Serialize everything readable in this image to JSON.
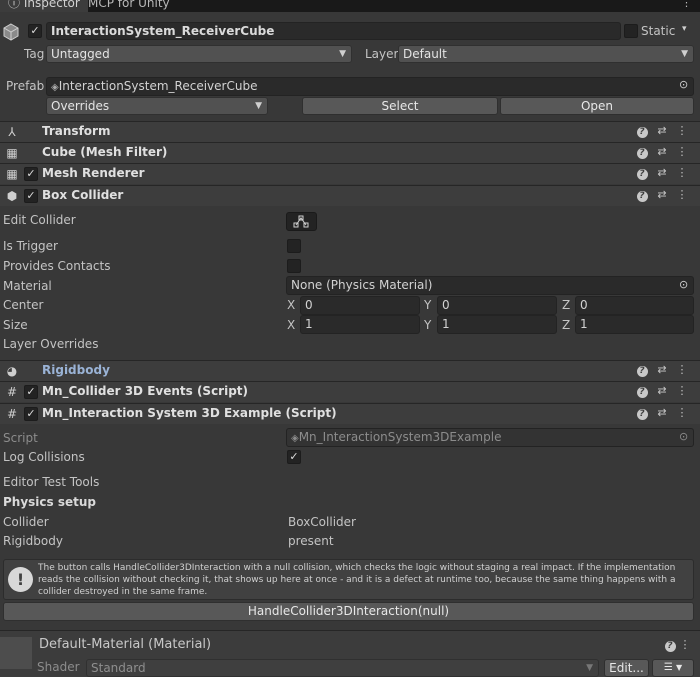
{
  "tabs": {
    "inspector": "Inspector",
    "mcp": "MCP for Unity"
  },
  "object": {
    "active": true,
    "name": "InteractionSystem_ReceiverCube",
    "static_label": "Static",
    "tag_label": "Tag",
    "tag_value": "Untagged",
    "layer_label": "Layer",
    "layer_value": "Default",
    "prefab_label": "Prefab",
    "prefab_value": "InteractionSystem_ReceiverCube",
    "overrides_label": "Overrides",
    "select_label": "Select",
    "open_label": "Open"
  },
  "components": {
    "transform": "Transform",
    "mesh_filter": "Cube (Mesh Filter)",
    "mesh_renderer": "Mesh Renderer",
    "box_collider": "Box Collider",
    "rigidbody": "Rigidbody",
    "collider_events": "Mn_Collider 3D Events (Script)",
    "interaction_example": "Mn_Interaction System 3D Example (Script)"
  },
  "box_collider": {
    "edit_collider": "Edit Collider",
    "is_trigger": "Is Trigger",
    "provides_contacts": "Provides Contacts",
    "material_label": "Material",
    "material_value": "None (Physics Material)",
    "center_label": "Center",
    "size_label": "Size",
    "layer_overrides": "Layer Overrides",
    "axes": {
      "x": "X",
      "y": "Y",
      "z": "Z"
    },
    "center": {
      "x": "0",
      "y": "0",
      "z": "0"
    },
    "size": {
      "x": "1",
      "y": "1",
      "z": "1"
    }
  },
  "example_script": {
    "script_label": "Script",
    "script_value": "Mn_InteractionSystem3DExample",
    "log_collisions_label": "Log Collisions",
    "log_collisions": true,
    "editor_test_tools": "Editor Test Tools",
    "physics_setup": "Physics setup",
    "collider_label": "Collider",
    "collider_value": "BoxCollider",
    "rigidbody_label": "Rigidbody",
    "rigidbody_value": "present",
    "help_text": "The button calls HandleCollider3DInteraction with a null collision, which checks the logic without staging a real impact. If the implementation reads the collision without checking it, that shows up here at once - and it is a defect at runtime too, because the same thing happens with a collider destroyed in the same frame.",
    "test_button": "HandleCollider3DInteraction(null)"
  },
  "material": {
    "title": "Default-Material (Material)",
    "shader_label": "Shader",
    "shader_value": "Standard",
    "edit_button": "Edit..."
  },
  "colors": {
    "background": "#383838",
    "header": "#3d3d3d",
    "field": "#2a2a2a"
  }
}
